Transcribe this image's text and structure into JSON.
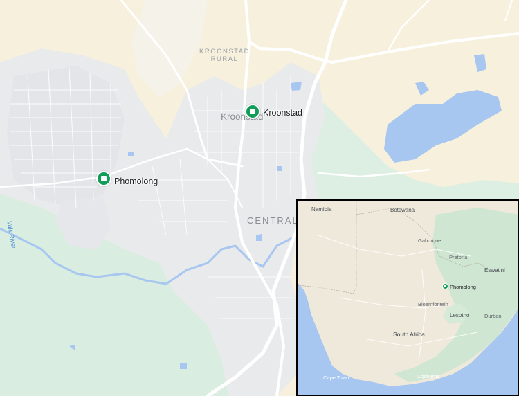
{
  "map": {
    "area_label": [
      "KROONSTAD",
      "RURAL"
    ],
    "ghost_label": "Kroonstad",
    "district_label": "CENTRAL",
    "river_label": "Vals River",
    "colors": {
      "land": "#f7f0dd",
      "urban": "#e9eaec",
      "green": "#d9ede0",
      "water": "#a7c6f0",
      "road": "#ffffff",
      "marker": "#0f9d58"
    }
  },
  "markers": [
    {
      "name": "Kroonstad",
      "icon": "place-marker-icon"
    },
    {
      "name": "Phomolong",
      "icon": "place-marker-icon"
    }
  ],
  "inset": {
    "countries": [
      "Namibia",
      "Botswana",
      "Eswatini",
      "Lesotho",
      "South Africa"
    ],
    "cities": [
      "Gaborone",
      "Pretoria",
      "Bloemfontein",
      "Durban",
      "Cape Town",
      "Gqeberha"
    ],
    "marker": {
      "name": "Phomolong"
    }
  }
}
